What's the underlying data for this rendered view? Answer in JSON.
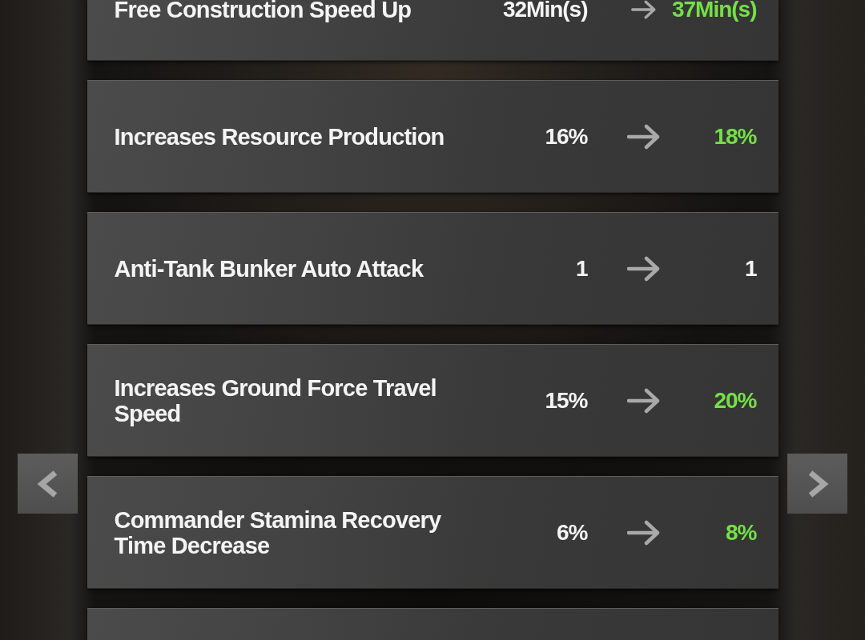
{
  "stats": [
    {
      "label": "Free Construction Speed Up",
      "current": "32Min(s)",
      "next": "37Min(s)",
      "improved": true
    },
    {
      "label": "Increases Resource Production",
      "current": "16%",
      "next": "18%",
      "improved": true
    },
    {
      "label": "Anti-Tank Bunker Auto Attack",
      "current": "1",
      "next": "1",
      "improved": false
    },
    {
      "label": "Increases Ground Force Travel Speed",
      "current": "15%",
      "next": "20%",
      "improved": true
    },
    {
      "label": "Commander Stamina Recovery Time Decrease",
      "current": "6%",
      "next": "8%",
      "improved": true
    }
  ]
}
